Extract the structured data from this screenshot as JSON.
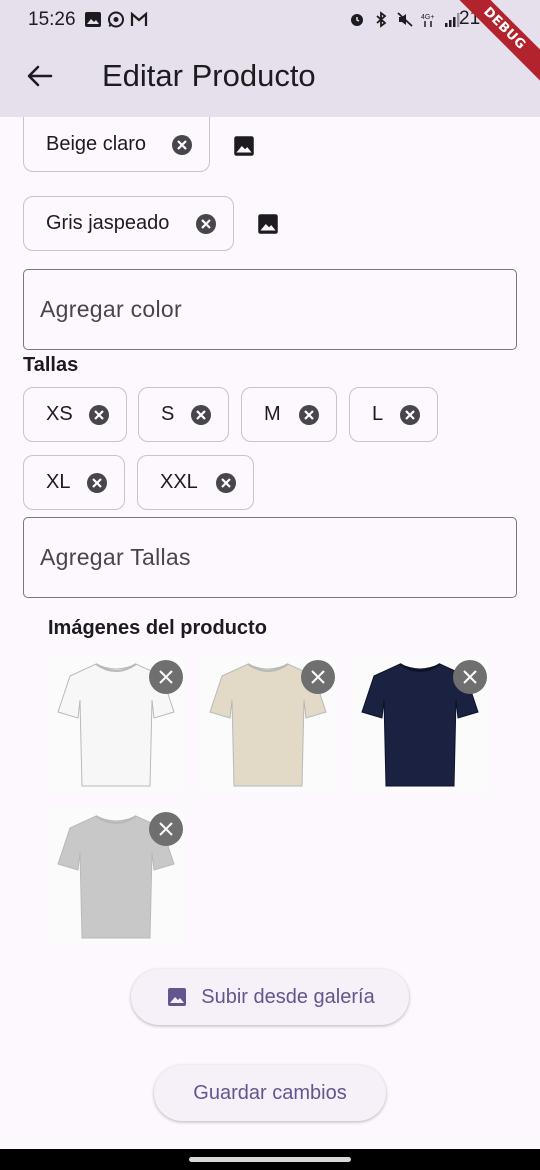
{
  "status_bar": {
    "time": "15:26",
    "battery": "21%",
    "network": "4G+",
    "debug_banner": "DEBUG"
  },
  "app_bar": {
    "title": "Editar Producto",
    "back_icon": "arrow-back-icon"
  },
  "colors": {
    "chips": [
      "Beige claro",
      "Gris jaspeado"
    ],
    "input_placeholder": "Agregar color"
  },
  "sizes": {
    "label": "Tallas",
    "chips": [
      "XS",
      "S",
      "M",
      "L",
      "XL",
      "XXL"
    ],
    "input_placeholder": "Agregar Tallas"
  },
  "images": {
    "label": "Imágenes del producto",
    "items": [
      {
        "shirt_color": "#f7f7f7"
      },
      {
        "shirt_color": "#e2d9c6"
      },
      {
        "shirt_color": "#1b2140"
      },
      {
        "shirt_color": "#c8c8c8"
      }
    ]
  },
  "actions": {
    "upload_label": "Subir desde galería",
    "save_label": "Guardar cambios"
  },
  "theme": {
    "primary": "#65558f",
    "surface": "#fdf7fe",
    "app_bar": "#e6e0ec"
  }
}
